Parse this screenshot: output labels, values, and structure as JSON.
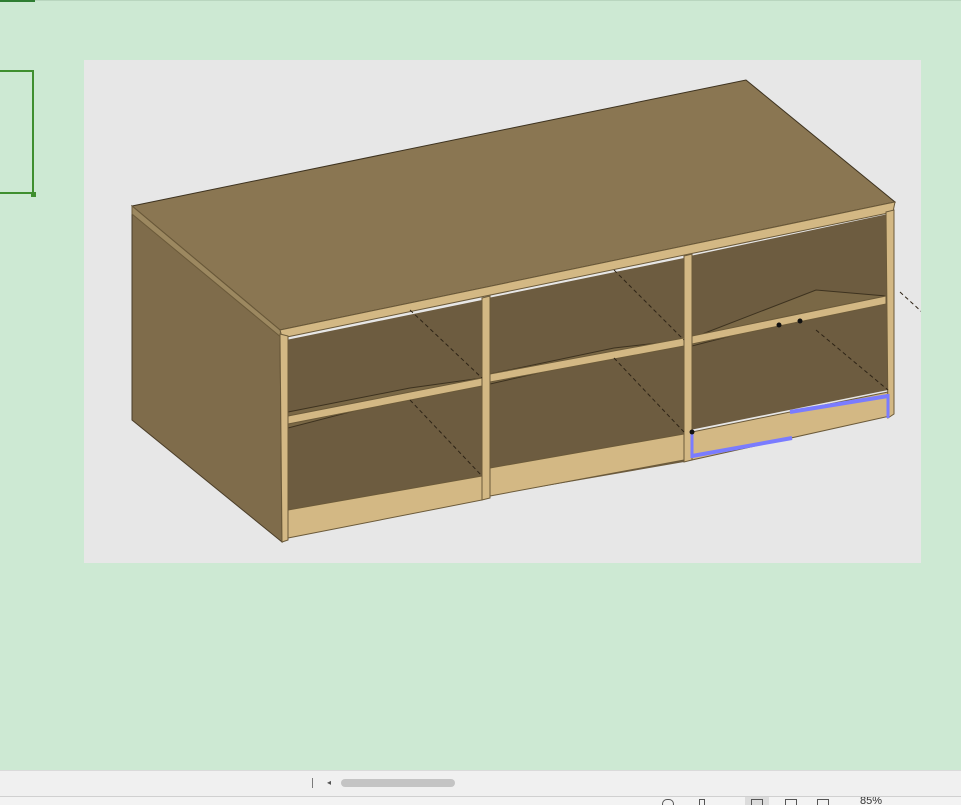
{
  "sheet": {
    "background_color": "#cde9d3",
    "selection_color": "#3f8f2f"
  },
  "picture": {
    "description_icon": "cabinet-3d-render",
    "wood_colors": {
      "top": "#8a7652",
      "side": "#7f6c4b",
      "front_edge": "#d3b884",
      "interior": "#6d5c40",
      "shelf_top": "#7a6846"
    },
    "highlight_color": "#7a7cff"
  },
  "statusbar": {
    "scroll_left_icon": "◂",
    "zoom_label": "85%",
    "views": [
      "normal-view-icon",
      "page-layout-icon",
      "page-break-icon"
    ]
  }
}
